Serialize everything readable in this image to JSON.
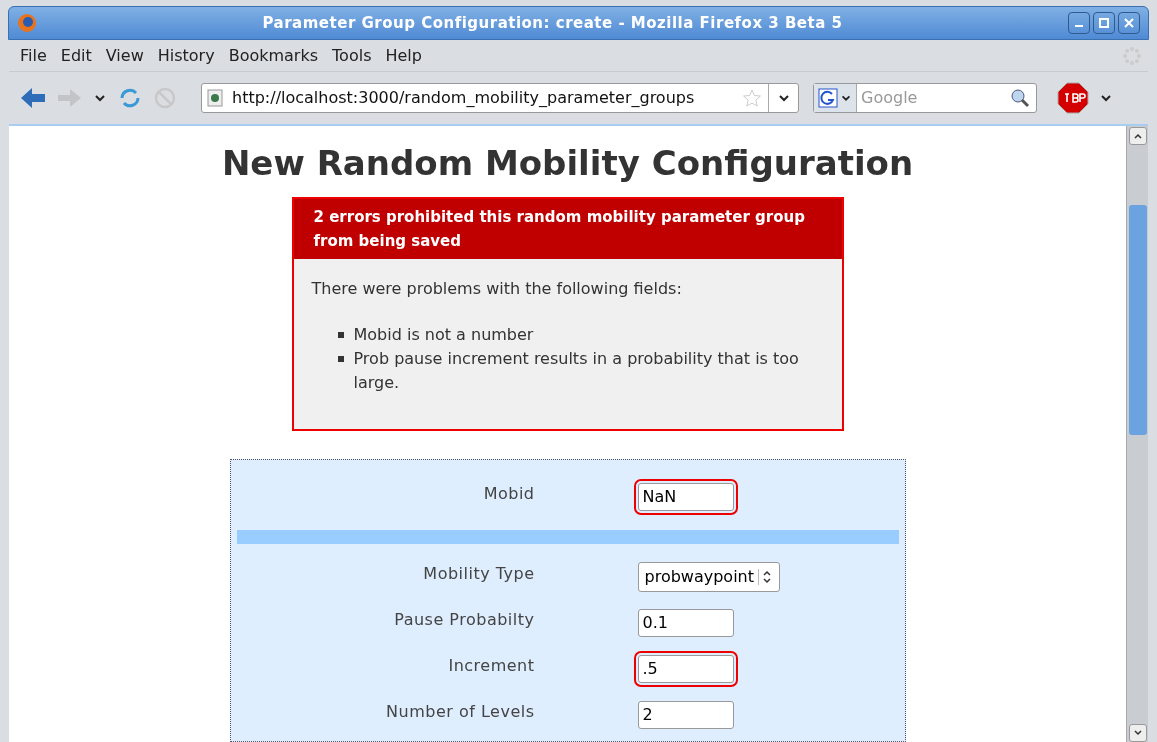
{
  "window": {
    "title": "Parameter Group Configuration: create - Mozilla Firefox 3 Beta 5"
  },
  "menu": [
    {
      "label": "File"
    },
    {
      "label": "Edit"
    },
    {
      "label": "View"
    },
    {
      "label": "History"
    },
    {
      "label": "Bookmarks"
    },
    {
      "label": "Tools"
    },
    {
      "label": "Help"
    }
  ],
  "toolbar": {
    "url": "http://localhost:3000/random_mobility_parameter_groups",
    "search": {
      "placeholder": "Google"
    }
  },
  "page": {
    "heading": "New Random Mobility Configuration",
    "errors": {
      "title": "2 errors prohibited this random mobility parameter group from being saved",
      "intro": "There were problems with the following fields:",
      "items": [
        "Mobid is not a number",
        "Prob pause increment results in a probability that is too large."
      ]
    },
    "form": [
      {
        "kind": "text",
        "label": "Mobid",
        "value": "NaN",
        "error": true
      },
      {
        "kind": "separator"
      },
      {
        "kind": "select",
        "label": "Mobility Type",
        "value": "probwaypoint",
        "error": false
      },
      {
        "kind": "text",
        "label": "Pause Probabilty",
        "value": "0.1",
        "error": false
      },
      {
        "kind": "text",
        "label": "Increment",
        "value": ".5",
        "error": true
      },
      {
        "kind": "text",
        "label": "Number of Levels",
        "value": "2",
        "error": false
      }
    ]
  }
}
